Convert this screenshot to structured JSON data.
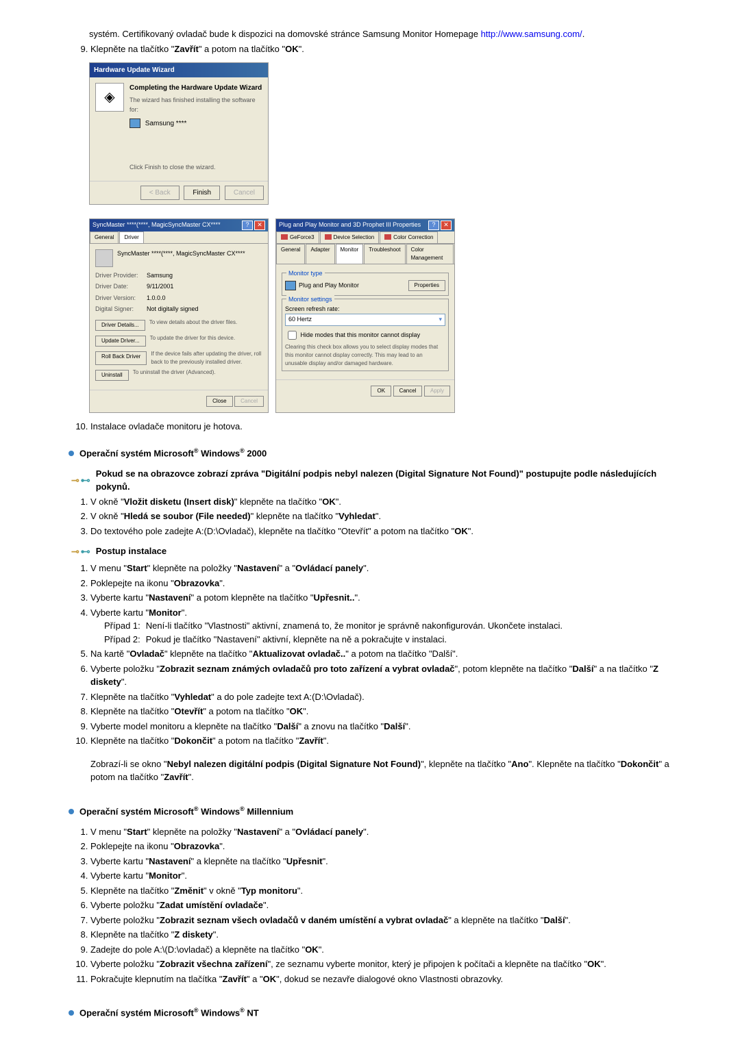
{
  "intro": {
    "p1_a": "systém. Certifikovaný ovladač bude k dispozici na domovské stránce Samsung Monitor Homepage",
    "url": "http://www.samsung.com/",
    "p1_b": ".",
    "item9_a": "Klepněte na tlačítko \"",
    "item9_b1": "Zavřít",
    "item9_c": "\" a potom na tlačítko \"",
    "item9_b2": "OK",
    "item9_d": "\"."
  },
  "wizard": {
    "title": "Hardware Update Wizard",
    "heading": "Completing the Hardware Update Wizard",
    "msg": "The wizard has finished installing the software for:",
    "device": "Samsung ****",
    "click_finish": "Click Finish to close the wizard.",
    "back": "< Back",
    "finish": "Finish",
    "cancel": "Cancel"
  },
  "dlg1": {
    "title": "SyncMaster ****(****, MagicSyncMaster CX****",
    "tab_general": "General",
    "tab_driver": "Driver",
    "device": "SyncMaster ****(****, MagicSyncMaster CX****",
    "r1l": "Driver Provider:",
    "r1v": "Samsung",
    "r2l": "Driver Date:",
    "r2v": "9/11/2001",
    "r3l": "Driver Version:",
    "r3v": "1.0.0.0",
    "r4l": "Digital Signer:",
    "r4v": "Not digitally signed",
    "b1": "Driver Details...",
    "b1d": "To view details about the driver files.",
    "b2": "Update Driver...",
    "b2d": "To update the driver for this device.",
    "b3": "Roll Back Driver",
    "b3d": "If the device fails after updating the driver, roll back to the previously installed driver.",
    "b4": "Uninstall",
    "b4d": "To uninstall the driver (Advanced).",
    "close": "Close",
    "cancel": "Cancel"
  },
  "dlg2": {
    "title": "Plug and Play Monitor and 3D Prophet III Properties",
    "tabs_row1": [
      "GeForce3",
      "Device Selection",
      "Color Correction"
    ],
    "tabs_row2": [
      "General",
      "Adapter",
      "Monitor",
      "Troubleshoot",
      "Color Management"
    ],
    "sec1": "Monitor type",
    "mon": "Plug and Play Monitor",
    "prop_btn": "Properties",
    "sec2": "Monitor settings",
    "refresh": "Screen refresh rate:",
    "refresh_val": "60 Hertz",
    "hide": "Hide modes that this monitor cannot display",
    "hide_desc": "Clearing this check box allows you to select display modes that this monitor cannot display correctly. This may lead to an unusable display and/or damaged hardware.",
    "ok": "OK",
    "cancel": "Cancel",
    "apply": "Apply"
  },
  "item10": "Instalace ovladače monitoru je hotova.",
  "win2000": {
    "title_a": "Operační systém Microsoft",
    "title_b": " Windows",
    "title_c": " 2000",
    "sig_found": "Pokud se na obrazovce zobrazí zpráva \"Digitální podpis nebyl nalezen (Digital Signature Not Found)\" postupujte podle následujících pokynů.",
    "l1a": "V okně \"",
    "l1b": "Vložit disketu (Insert disk)",
    "l1c": "\" klepněte na tlačítko \"",
    "l1d": "OK",
    "l1e": "\".",
    "l2a": "V okně \"",
    "l2b": "Hledá se soubor (File needed)",
    "l2c": "\" klepněte na tlačítko \"",
    "l2d": "Vyhledat",
    "l2e": "\".",
    "l3a": "Do textového pole zadejte A:(D:\\Ovladač), klepněte na tlačítko \"Otevřít\" a potom na tlačítko \"",
    "l3b": "OK",
    "l3c": "\".",
    "install_title": "Postup instalace",
    "i1a": "V menu \"",
    "i1b": "Start",
    "i1c": "\" klepněte na položky \"",
    "i1d": "Nastavení",
    "i1e": "\" a \"",
    "i1f": "Ovládací panely",
    "i1g": "\".",
    "i2a": "Poklepejte na ikonu \"",
    "i2b": "Obrazovka",
    "i2c": "\".",
    "i3a": "Vyberte kartu \"",
    "i3b": "Nastavení",
    "i3c": "\" a potom klepněte na tlačítko \"",
    "i3d": "Upřesnit..",
    "i3e": "\".",
    "i4a": "Vyberte kartu \"",
    "i4b": "Monitor",
    "i4c": "\".",
    "c1l": "Případ 1:",
    "c1t": "Není-li tlačítko \"Vlastnosti\" aktivní, znamená to, že monitor je správně nakonfigurován. Ukončete instalaci.",
    "c2l": "Případ 2:",
    "c2t": "Pokud je tlačítko \"Nastavení\" aktivní, klepněte na ně a pokračujte v instalaci.",
    "i5a": "Na kartě \"",
    "i5b": "Ovladač",
    "i5c": "\" klepněte na tlačítko \"",
    "i5d": "Aktualizovat ovladač..",
    "i5e": "\" a potom na tlačítko \"Další\".",
    "i6a": "Vyberte položku \"",
    "i6b": "Zobrazit seznam známých ovladačů pro toto zařízení a vybrat ovladač",
    "i6c": "\", potom klepněte na tlačítko \"",
    "i6d": "Další",
    "i6e": "\" a na tlačítko \"",
    "i6f": "Z diskety",
    "i6g": "\".",
    "i7a": "Klepněte na tlačítko \"",
    "i7b": "Vyhledat",
    "i7c": "\" a do pole zadejte text A:(D:\\Ovladač).",
    "i8a": "Klepněte na tlačítko \"",
    "i8b": "Otevřít",
    "i8c": "\" a potom na tlačítko \"",
    "i8d": "OK",
    "i8e": "\".",
    "i9a": "Vyberte model monitoru a klepněte na tlačítko \"",
    "i9b": "Další",
    "i9c": "\" a znovu na tlačítko \"",
    "i9d": "Další",
    "i9e": "\".",
    "i10a": "Klepněte na tlačítko \"",
    "i10b": "Dokončit",
    "i10c": "\" a potom na tlačítko \"",
    "i10d": "Zavřít",
    "i10e": "\".",
    "note_a": "Zobrazí-li se okno \"",
    "note_b": "Nebyl nalezen digitální podpis (Digital Signature Not Found)",
    "note_c": "\", klepněte na tlačítko \"",
    "note_d": "Ano",
    "note_e": "\". Klepněte na tlačítko \"",
    "note_f": "Dokončit",
    "note_g": "\" a potom na tlačítko \"",
    "note_h": "Zavřít",
    "note_i": "\"."
  },
  "winme": {
    "title_a": "Operační systém Microsoft",
    "title_b": " Windows",
    "title_c": " Millennium",
    "l1a": "V menu \"",
    "l1b": "Start",
    "l1c": "\" klepněte na položky \"",
    "l1d": "Nastavení",
    "l1e": "\" a \"",
    "l1f": "Ovládací panely",
    "l1g": "\".",
    "l2a": "Poklepejte na ikonu \"",
    "l2b": "Obrazovka",
    "l2c": "\".",
    "l3a": "Vyberte kartu \"",
    "l3b": "Nastavení",
    "l3c": "\" a klepněte na tlačítko \"",
    "l3d": "Upřesnit",
    "l3e": "\".",
    "l4a": "Vyberte kartu \"",
    "l4b": "Monitor",
    "l4c": "\".",
    "l5a": "Klepněte na tlačítko \"",
    "l5b": "Změnit",
    "l5c": "\" v okně \"",
    "l5d": "Typ monitoru",
    "l5e": "\".",
    "l6a": "Vyberte položku \"",
    "l6b": "Zadat umístění ovladače",
    "l6c": "\".",
    "l7a": "Vyberte položku \"",
    "l7b": "Zobrazit seznam všech ovladačů v daném umístění a vybrat ovladač",
    "l7c": "\" a klepněte na tlačítko \"",
    "l7d": "Další",
    "l7e": "\".",
    "l8a": "Klepněte na tlačítko \"",
    "l8b": "Z diskety",
    "l8c": "\".",
    "l9a": "Zadejte do pole A:\\(D:\\ovladač) a klepněte na tlačítko \"",
    "l9b": "OK",
    "l9c": "\".",
    "l10a": "Vyberte položku \"",
    "l10b": "Zobrazit všechna zařízení",
    "l10c": "\", ze seznamu vyberte monitor, který je připojen k počítači a klepněte na tlačítko \"",
    "l10d": "OK",
    "l10e": "\".",
    "l11a": "Pokračujte klepnutím na tlačítka \"",
    "l11b": "Zavřít",
    "l11c": "\" a \"",
    "l11d": "OK",
    "l11e": "\", dokud se nezavře dialogové okno Vlastnosti obrazovky."
  },
  "winnt": {
    "title_a": "Operační systém Microsoft",
    "title_b": " Windows",
    "title_c": " NT"
  }
}
